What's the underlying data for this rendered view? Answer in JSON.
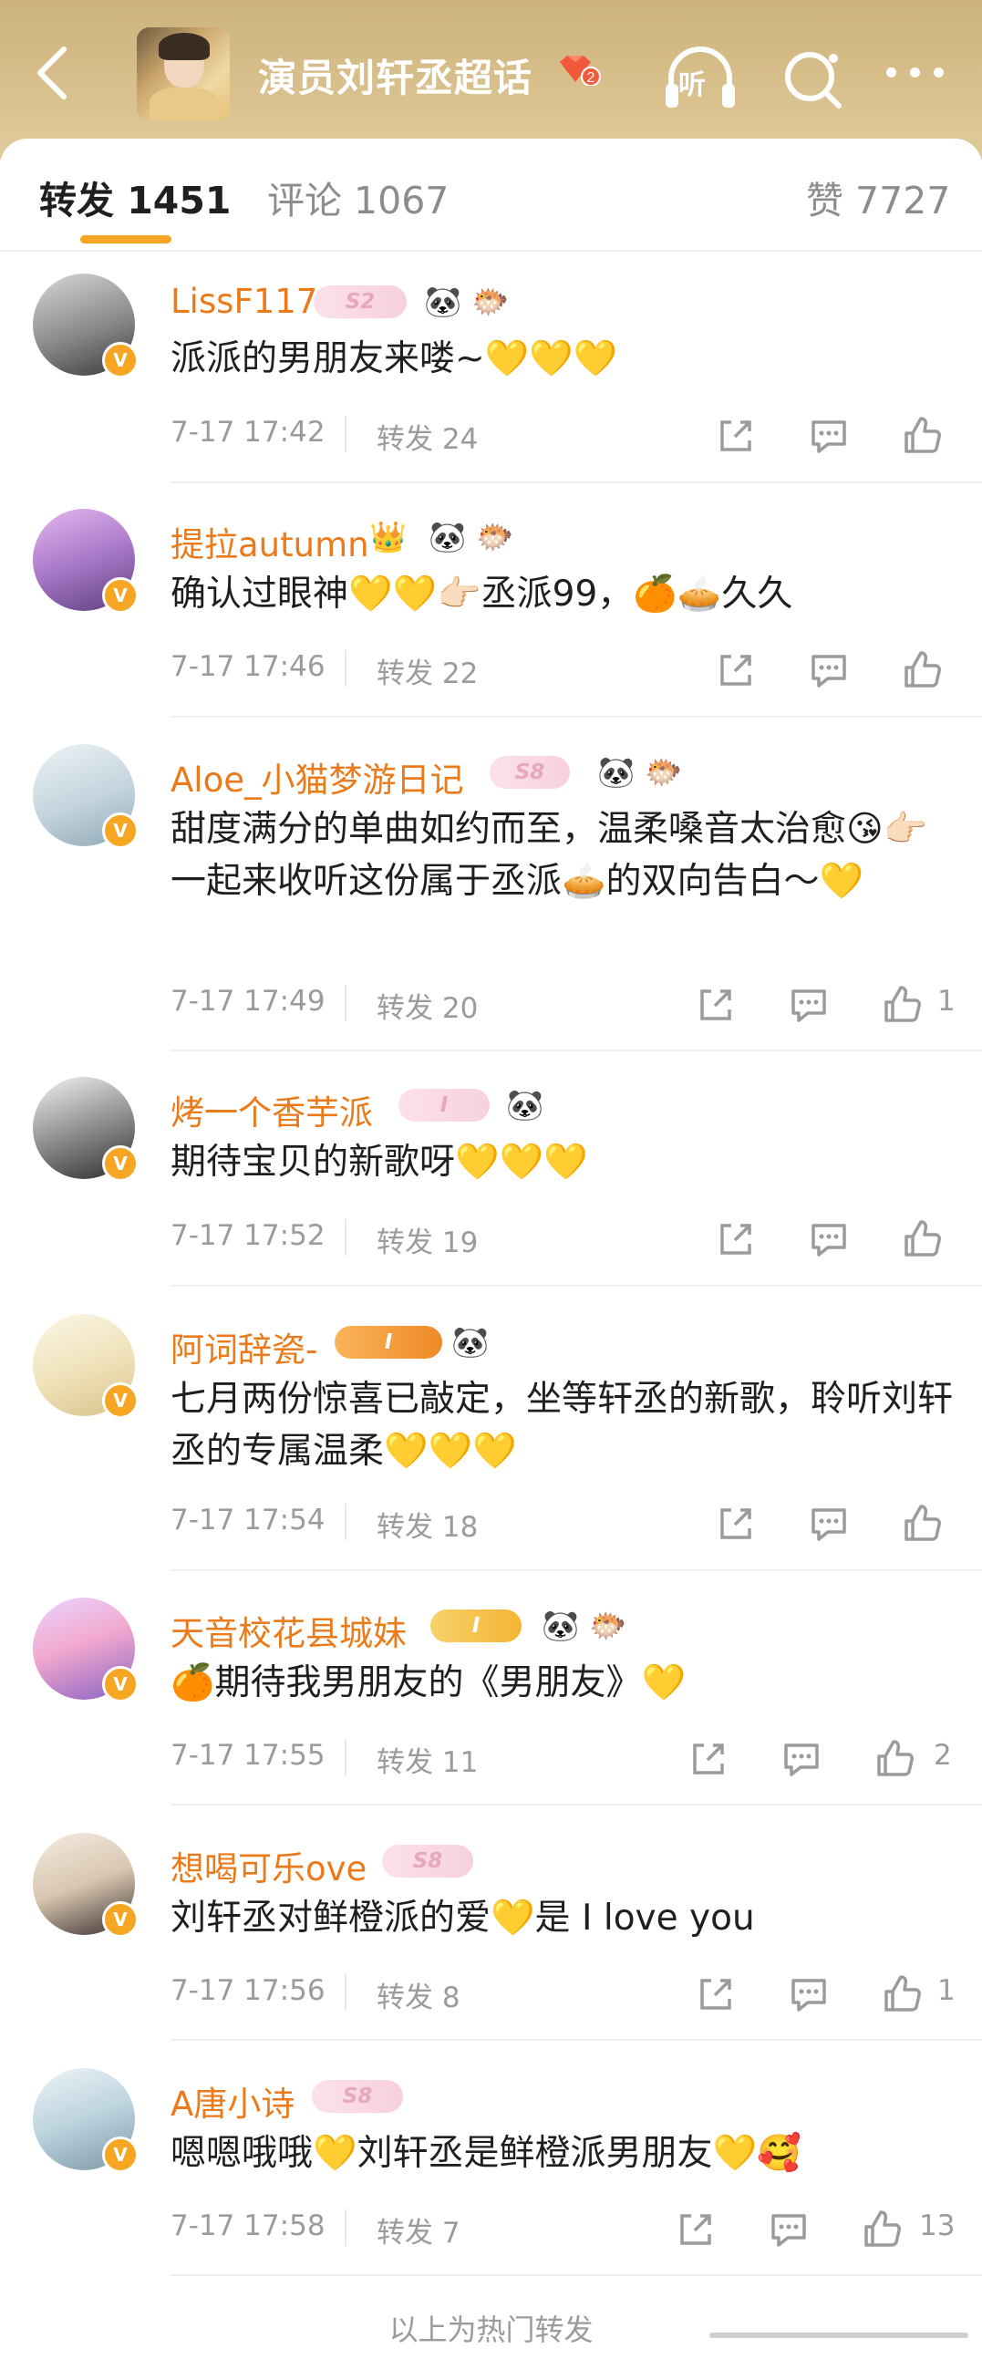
{
  "header": {
    "topic_title": "演员刘轩丞超话",
    "listen_label": "听",
    "topic_level_badge": "2"
  },
  "tabs": {
    "repost_label": "转发",
    "repost_count": "1451",
    "comment_label": "评论",
    "comment_count": "1067",
    "like_label": "赞",
    "like_count": "7727"
  },
  "comments": [
    {
      "username": "LissF117",
      "level": "S2",
      "marks": [
        "🐼",
        "🐡"
      ],
      "content": "派派的男朋友来喽~💛💛💛",
      "time": "7-17 17:42",
      "repost": "转发 24",
      "likes": ""
    },
    {
      "username": "提拉autumn",
      "level": "",
      "marks": [
        "👑",
        "🐼",
        "🐡"
      ],
      "content": "确认过眼神💛💛👉🏻丞派99，🍊🥧久久",
      "time": "7-17 17:46",
      "repost": "转发 22",
      "likes": ""
    },
    {
      "username": "Aloe_小猫梦游日记",
      "level": "S8",
      "marks": [
        "🐼",
        "🐡"
      ],
      "content": "甜度满分的单曲如约而至，温柔嗓音太治愈😘👉🏻一起来收听这份属于丞派🥧的双向告白～💛",
      "time": "7-17 17:49",
      "repost": "转发 20",
      "likes": "1"
    },
    {
      "username": "烤一个香芋派",
      "level": "I",
      "marks": [
        "🐼"
      ],
      "content": "期待宝贝的新歌呀💛💛💛",
      "time": "7-17 17:52",
      "repost": "转发 19",
      "likes": ""
    },
    {
      "username": "阿词辞瓷-",
      "level": "I",
      "marks": [
        "🐼"
      ],
      "content": "七月两份惊喜已敲定，坐等轩丞的新歌，聆听刘轩丞的专属温柔💛💛💛",
      "time": "7-17 17:54",
      "repost": "转发 18",
      "likes": ""
    },
    {
      "username": "天音校花县城妹",
      "level": "I",
      "marks": [
        "🐼",
        "🐡"
      ],
      "content": "🍊期待我男朋友的《男朋友》💛",
      "time": "7-17 17:55",
      "repost": "转发 11",
      "likes": "2"
    },
    {
      "username": "想喝可乐ove",
      "level": "S8",
      "marks": [],
      "content": "刘轩丞对鲜橙派的爱💛是 I love you",
      "time": "7-17 17:56",
      "repost": "转发 8",
      "likes": "1"
    },
    {
      "username": "A唐小诗",
      "level": "S8",
      "marks": [],
      "content": "嗯嗯哦哦💛刘轩丞是鲜橙派男朋友💛🥰",
      "time": "7-17 17:58",
      "repost": "转发 7",
      "likes": "13"
    }
  ],
  "footer": {
    "text": "以上为热门转发"
  }
}
